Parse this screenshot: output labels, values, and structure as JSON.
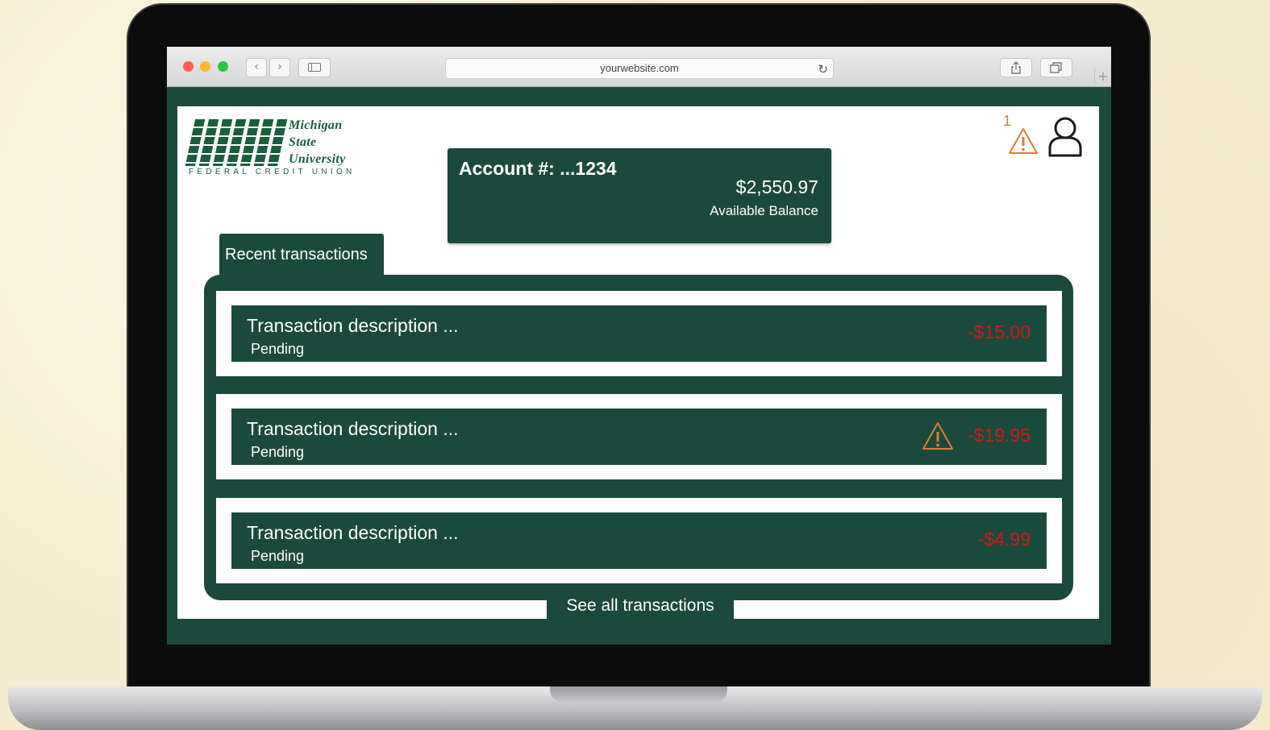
{
  "browser": {
    "url": "yourwebsite.com",
    "icons": {
      "back": "chevron-left-icon",
      "forward": "chevron-right-icon",
      "reload": "reload-icon",
      "share": "share-icon",
      "tabs": "tabs-icon",
      "new_tab": "plus-icon"
    }
  },
  "logo": {
    "line1": "Michigan",
    "line2": "State",
    "line3": "University",
    "subtitle": "FEDERAL CREDIT UNION"
  },
  "header": {
    "alert_count": "1",
    "alert_icon": "warning-triangle-icon",
    "user_icon": "user-icon"
  },
  "account": {
    "label": "Account #: ...1234",
    "balance": "$2,550.97",
    "balance_label": "Available Balance"
  },
  "transactions": {
    "tab_label": "Recent transactions",
    "items": [
      {
        "description": "Transaction description ...",
        "status": "Pending",
        "amount": "-$15.00",
        "warning": false
      },
      {
        "description": "Transaction description ...",
        "status": "Pending",
        "amount": "-$19.95",
        "warning": true
      },
      {
        "description": "Transaction description ...",
        "status": "Pending",
        "amount": "-$4.99",
        "warning": false
      }
    ],
    "see_all_label": "See all transactions"
  },
  "colors": {
    "brand_green": "#1b4a3c",
    "logo_green": "#1b5e3b",
    "negative_amount": "#cc1a1a",
    "alert_orange": "#e07b38"
  }
}
